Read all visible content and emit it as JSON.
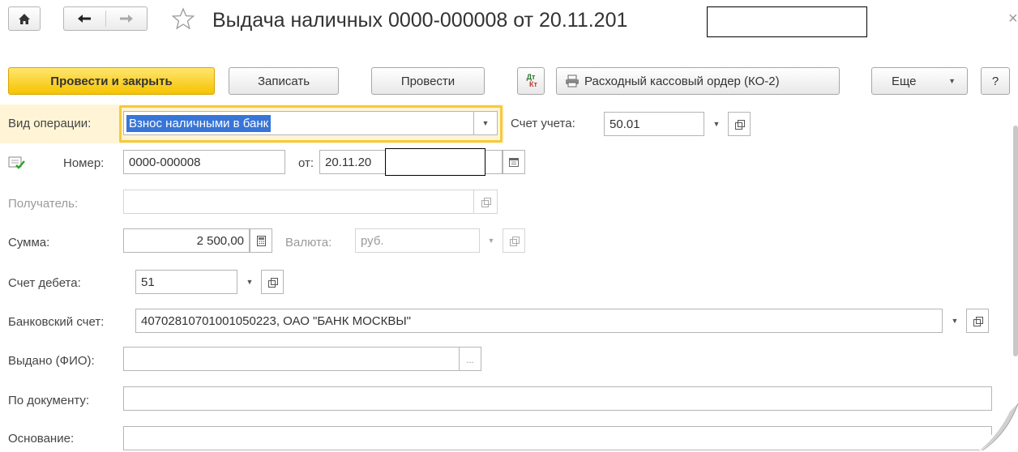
{
  "header": {
    "title": "Выдача наличных 0000-000008 от 20.11.201",
    "close_glyph": "×"
  },
  "toolbar": {
    "post_close": "Провести и закрыть",
    "save": "Записать",
    "post": "Провести",
    "dtkt_top": "Дт",
    "dtkt_bottom": "Кт",
    "print_order": "Расходный кассовый ордер (КО-2)",
    "more": "Еще",
    "help": "?"
  },
  "form": {
    "operation_type": {
      "label": "Вид операции:",
      "value": "Взнос наличными в банк"
    },
    "account": {
      "label": "Счет учета:",
      "value": "50.01"
    },
    "number": {
      "label": "Номер:",
      "value": "0000-000008"
    },
    "date": {
      "label": "от:",
      "value": "20.11.20"
    },
    "recipient": {
      "label": "Получатель:",
      "value": ""
    },
    "sum": {
      "label": "Сумма:",
      "value": "2 500,00"
    },
    "currency": {
      "label": "Валюта:",
      "value": "руб."
    },
    "debit_account": {
      "label": "Счет дебета:",
      "value": "51"
    },
    "bank_account": {
      "label": "Банковский счет:",
      "value": "40702810701001050223, ОАО \"БАНК МОСКВЫ\""
    },
    "issued_to": {
      "label": "Выдано (ФИО):",
      "value": "",
      "button": "..."
    },
    "by_document": {
      "label": "По документу:",
      "value": ""
    },
    "basis": {
      "label": "Основание:",
      "value": ""
    }
  },
  "colors": {
    "primary_button": "#f5c300",
    "focus_border": "#f7c93a",
    "selection": "#3875d7"
  }
}
